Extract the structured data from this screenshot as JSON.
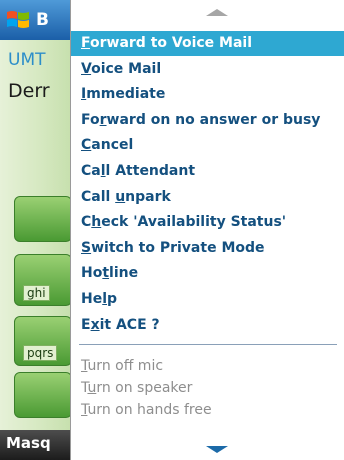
{
  "app": {
    "title": "B",
    "umts": "UMT",
    "name": "Derr",
    "keys": [
      "ghi",
      "pqrs"
    ],
    "bottom": "Masq"
  },
  "menu": {
    "items": [
      {
        "before": "",
        "key": "F",
        "after": "orward to Voice Mail",
        "state": "selected"
      },
      {
        "before": "",
        "key": "V",
        "after": "oice Mail",
        "state": "normal"
      },
      {
        "before": "",
        "key": "I",
        "after": "mmediate",
        "state": "normal"
      },
      {
        "before": "Fo",
        "key": "r",
        "after": "ward on no answer or busy",
        "state": "normal"
      },
      {
        "before": "",
        "key": "C",
        "after": "ancel",
        "state": "normal"
      },
      {
        "before": "Ca",
        "key": "l",
        "after": "l Attendant",
        "state": "normal"
      },
      {
        "before": "Call ",
        "key": "u",
        "after": "npark",
        "state": "normal"
      },
      {
        "before": "C",
        "key": "h",
        "after": "eck 'Availability Status'",
        "state": "normal"
      },
      {
        "before": "",
        "key": "S",
        "after": "witch to Private Mode",
        "state": "normal"
      },
      {
        "before": "Ho",
        "key": "t",
        "after": "line",
        "state": "normal"
      },
      {
        "before": "He",
        "key": "l",
        "after": "p",
        "state": "normal"
      },
      {
        "before": "E",
        "key": "x",
        "after": "it ACE ?",
        "state": "normal"
      }
    ],
    "secondary": [
      {
        "before": "",
        "key": "T",
        "after": "urn off mic",
        "state": "disabled"
      },
      {
        "before": "T",
        "key": "u",
        "after": "rn on speaker",
        "state": "disabled"
      },
      {
        "before": "",
        "key": "T",
        "after": "urn on hands free",
        "state": "disabled"
      }
    ]
  },
  "colors": {
    "selected_bg": "#2ea8d2",
    "item_text": "#14507f",
    "disabled_text": "#8e8e8e"
  },
  "icons": {
    "start": "windows-flag-icon",
    "scroll_up": "scroll-up-arrow-icon",
    "scroll_down": "scroll-down-arrow-icon"
  }
}
